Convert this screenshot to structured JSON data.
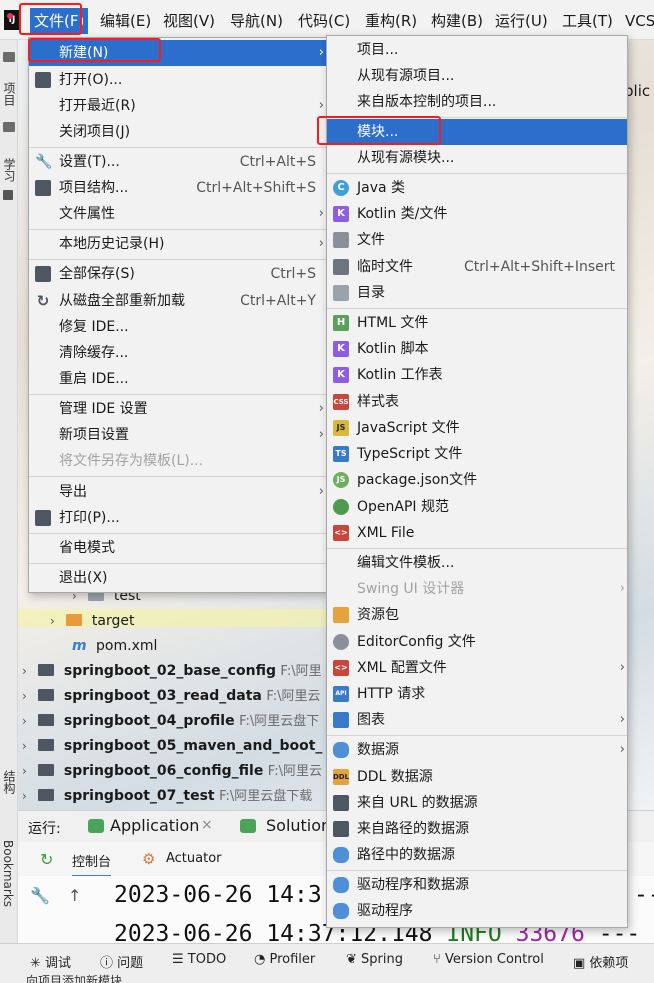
{
  "menubar": {
    "logo": "IJ",
    "items": [
      "文件(F)",
      "编辑(E)",
      "视图(V)",
      "导航(N)",
      "代码(C)",
      "重构(R)",
      "构建(B)",
      "运行(U)",
      "工具(T)",
      "VCS"
    ]
  },
  "left_strip": {
    "project_label": "项目",
    "learn_label": "学习",
    "structure_label": "结构",
    "bookmarks_label": "Bookmarks"
  },
  "file_menu": {
    "items": [
      {
        "label": "新建(N)",
        "shortcut": "",
        "submenu": true
      },
      {
        "label": "打开(O)...",
        "shortcut": ""
      },
      {
        "label": "打开最近(R)",
        "shortcut": "",
        "submenu": true
      },
      {
        "label": "关闭项目(J)",
        "shortcut": ""
      },
      {
        "label": "设置(T)...",
        "shortcut": "Ctrl+Alt+S"
      },
      {
        "label": "项目结构...",
        "shortcut": "Ctrl+Alt+Shift+S"
      },
      {
        "label": "文件属性",
        "shortcut": "",
        "submenu": true
      },
      {
        "label": "本地历史记录(H)",
        "shortcut": "",
        "submenu": true
      },
      {
        "label": "全部保存(S)",
        "shortcut": "Ctrl+S"
      },
      {
        "label": "从磁盘全部重新加载",
        "shortcut": "Ctrl+Alt+Y"
      },
      {
        "label": "修复 IDE...",
        "shortcut": ""
      },
      {
        "label": "清除缓存...",
        "shortcut": ""
      },
      {
        "label": "重启 IDE...",
        "shortcut": ""
      },
      {
        "label": "管理 IDE 设置",
        "shortcut": "",
        "submenu": true
      },
      {
        "label": "新项目设置",
        "shortcut": "",
        "submenu": true
      },
      {
        "label": "将文件另存为模板(L)...",
        "shortcut": ""
      },
      {
        "label": "导出",
        "shortcut": "",
        "submenu": true
      },
      {
        "label": "打印(P)...",
        "shortcut": ""
      },
      {
        "label": "省电模式",
        "shortcut": ""
      },
      {
        "label": "退出(X)",
        "shortcut": ""
      }
    ]
  },
  "new_menu": {
    "items": [
      {
        "label": "项目..."
      },
      {
        "label": "从现有源项目..."
      },
      {
        "label": "来自版本控制的项目..."
      },
      {
        "label": "模块..."
      },
      {
        "label": "从现有源模块..."
      },
      {
        "label": "Java 类",
        "icon": "C"
      },
      {
        "label": "Kotlin 类/文件",
        "icon": "K"
      },
      {
        "label": "文件"
      },
      {
        "label": "临时文件",
        "shortcut": "Ctrl+Alt+Shift+Insert"
      },
      {
        "label": "目录"
      },
      {
        "label": "HTML 文件",
        "icon": "H"
      },
      {
        "label": "Kotlin 脚本",
        "icon": "K"
      },
      {
        "label": "Kotlin 工作表",
        "icon": "K"
      },
      {
        "label": "样式表",
        "icon": "CSS"
      },
      {
        "label": "JavaScript 文件",
        "icon": "JS"
      },
      {
        "label": "TypeScript 文件",
        "icon": "TS"
      },
      {
        "label": "package.json文件",
        "icon": "JS"
      },
      {
        "label": "OpenAPI 规范"
      },
      {
        "label": "XML File",
        "icon": "<>"
      },
      {
        "label": "编辑文件模板..."
      },
      {
        "label": "Swing UI 设计器"
      },
      {
        "label": "资源包"
      },
      {
        "label": "EditorConfig 文件"
      },
      {
        "label": "XML 配置文件",
        "icon": "<>"
      },
      {
        "label": "HTTP 请求",
        "icon": "API"
      },
      {
        "label": "图表"
      },
      {
        "label": "数据源"
      },
      {
        "label": "DDL 数据源",
        "icon": "DDL"
      },
      {
        "label": "来自 URL 的数据源"
      },
      {
        "label": "来自路径的数据源"
      },
      {
        "label": "路径中的数据源"
      },
      {
        "label": "驱动程序和数据源"
      },
      {
        "label": "驱动程序"
      }
    ]
  },
  "project_tree": {
    "rows": [
      {
        "name": "test",
        "path": ""
      },
      {
        "name": "target",
        "path": ""
      },
      {
        "name": "pom.xml",
        "path": ""
      },
      {
        "name": "springboot_02_base_config",
        "path": "F:\\阿里"
      },
      {
        "name": "springboot_03_read_data",
        "path": "F:\\阿里云"
      },
      {
        "name": "springboot_04_profile",
        "path": "F:\\阿里云盘下"
      },
      {
        "name": "springboot_05_maven_and_boot_",
        "path": ""
      },
      {
        "name": "springboot_06_config_file",
        "path": "F:\\阿里云"
      },
      {
        "name": "springboot_07_test",
        "path": "F:\\阿里云盘下载"
      }
    ],
    "editor_peek": "plic"
  },
  "run_panel": {
    "label": "运行:",
    "app_tab": "Application",
    "close": "×",
    "other_tab": "Solution",
    "console_tab": "控制台",
    "actuator_tab": "Actuator",
    "log1": {
      "time": "2023-06-26 14:3",
      "rest": "--"
    },
    "log2": {
      "time": "2023-06-26 14:37:12.148",
      "level": "INFO",
      "pid": "33676",
      "rest": "---"
    }
  },
  "statusbar": {
    "items": [
      "调试",
      "问题",
      "TODO",
      "Profiler",
      "Spring",
      "Version Control",
      "依赖项"
    ],
    "note": "向项目添加新模块"
  },
  "colors": {
    "selection": "#2b6ecc",
    "annotation_red": "#ff1a1a"
  }
}
